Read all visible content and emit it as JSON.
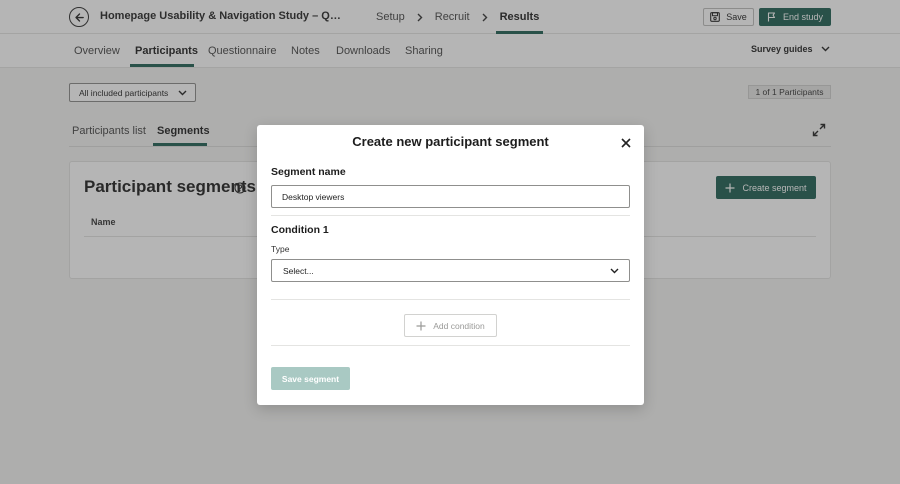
{
  "header": {
    "study_title": "Homepage Usability & Navigation Study – Q…",
    "steps": [
      "Setup",
      "Recruit",
      "Results"
    ],
    "active_step": "Results",
    "save_label": "Save",
    "end_study_label": "End study"
  },
  "subnav": {
    "tabs": [
      "Overview",
      "Participants",
      "Questionnaire",
      "Notes",
      "Downloads",
      "Sharing"
    ],
    "active_tab": "Participants",
    "survey_guides_label": "Survey guides"
  },
  "filters": {
    "participant_filter": "All included participants",
    "count_label": "1 of 1 Participants"
  },
  "inner_tabs": {
    "items": [
      "Participants list",
      "Segments"
    ],
    "active": "Segments"
  },
  "segments_card": {
    "title": "Participant segments",
    "create_button": "Create segment",
    "column_name": "Name"
  },
  "modal": {
    "title": "Create new participant segment",
    "segment_name_label": "Segment name",
    "segment_name_value": "Desktop viewers",
    "condition_label": "Condition 1",
    "type_label": "Type",
    "type_select_value": "Select...",
    "add_condition_label": "Add condition",
    "save_segment_label": "Save segment"
  },
  "colors": {
    "accent": "#1e5e52",
    "accent_disabled": "#a9c9c3"
  }
}
